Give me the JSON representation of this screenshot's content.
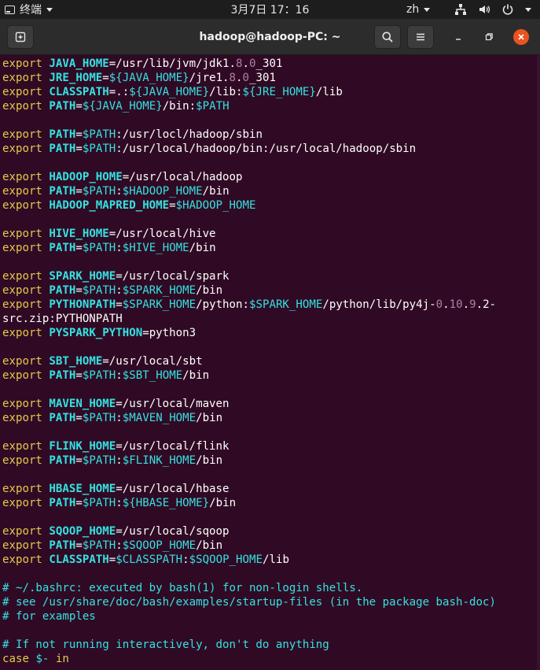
{
  "topbar": {
    "app_name": "终端",
    "clock": "3月7日  17：16",
    "language": "zh"
  },
  "window": {
    "title": "hadoop@hadoop-PC: ~"
  },
  "terminal": {
    "lines": [
      [
        [
          "kw",
          "export "
        ],
        [
          "var",
          "JAVA_HOME"
        ],
        [
          "plain",
          "=/usr/lib/jvm/jdk1."
        ],
        [
          "num",
          "8"
        ],
        [
          "plain",
          "."
        ],
        [
          "num",
          "0"
        ],
        [
          "plain",
          "_301"
        ]
      ],
      [
        [
          "kw",
          "export "
        ],
        [
          "var",
          "JRE_HOME"
        ],
        [
          "plain",
          "="
        ],
        [
          "val",
          "${JAVA_HOME}"
        ],
        [
          "plain",
          "/jre1."
        ],
        [
          "num",
          "8"
        ],
        [
          "plain",
          "."
        ],
        [
          "num",
          "0"
        ],
        [
          "plain",
          "_301"
        ]
      ],
      [
        [
          "kw",
          "export "
        ],
        [
          "var",
          "CLASSPATH"
        ],
        [
          "plain",
          "=.:"
        ],
        [
          "val",
          "${JAVA_HOME}"
        ],
        [
          "plain",
          "/lib:"
        ],
        [
          "val",
          "${JRE_HOME}"
        ],
        [
          "plain",
          "/lib"
        ]
      ],
      [
        [
          "kw",
          "export "
        ],
        [
          "var",
          "PATH"
        ],
        [
          "plain",
          "="
        ],
        [
          "val",
          "${JAVA_HOME}"
        ],
        [
          "plain",
          "/bin:"
        ],
        [
          "val",
          "$PATH"
        ]
      ],
      [],
      [
        [
          "kw",
          "export "
        ],
        [
          "var",
          "PATH"
        ],
        [
          "plain",
          "="
        ],
        [
          "val",
          "$PATH"
        ],
        [
          "plain",
          ":/usr/locl/hadoop/sbin"
        ]
      ],
      [
        [
          "kw",
          "export "
        ],
        [
          "var",
          "PATH"
        ],
        [
          "plain",
          "="
        ],
        [
          "val",
          "$PATH"
        ],
        [
          "plain",
          ":/usr/local/hadoop/bin:/usr/local/hadoop/sbin"
        ]
      ],
      [],
      [
        [
          "kw",
          "export "
        ],
        [
          "var",
          "HADOOP_HOME"
        ],
        [
          "plain",
          "=/usr/local/hadoop"
        ]
      ],
      [
        [
          "kw",
          "export "
        ],
        [
          "var",
          "PATH"
        ],
        [
          "plain",
          "="
        ],
        [
          "val",
          "$PATH"
        ],
        [
          "plain",
          ":"
        ],
        [
          "val",
          "$HADOOP_HOME"
        ],
        [
          "plain",
          "/bin"
        ]
      ],
      [
        [
          "kw",
          "export "
        ],
        [
          "var",
          "HADOOP_MAPRED_HOME"
        ],
        [
          "plain",
          "="
        ],
        [
          "val",
          "$HADOOP_HOME"
        ]
      ],
      [],
      [
        [
          "kw",
          "export "
        ],
        [
          "var",
          "HIVE_HOME"
        ],
        [
          "plain",
          "=/usr/local/hive"
        ]
      ],
      [
        [
          "kw",
          "export "
        ],
        [
          "var",
          "PATH"
        ],
        [
          "plain",
          "="
        ],
        [
          "val",
          "$PATH"
        ],
        [
          "plain",
          ":"
        ],
        [
          "val",
          "$HIVE_HOME"
        ],
        [
          "plain",
          "/bin"
        ]
      ],
      [],
      [
        [
          "kw",
          "export "
        ],
        [
          "var",
          "SPARK_HOME"
        ],
        [
          "plain",
          "=/usr/local/spark"
        ]
      ],
      [
        [
          "kw",
          "export "
        ],
        [
          "var",
          "PATH"
        ],
        [
          "plain",
          "="
        ],
        [
          "val",
          "$PATH"
        ],
        [
          "plain",
          ":"
        ],
        [
          "val",
          "$SPARK_HOME"
        ],
        [
          "plain",
          "/bin"
        ]
      ],
      [
        [
          "kw",
          "export "
        ],
        [
          "var",
          "PYTHONPATH"
        ],
        [
          "plain",
          "="
        ],
        [
          "val",
          "$SPARK_HOME"
        ],
        [
          "plain",
          "/python:"
        ],
        [
          "val",
          "$SPARK_HOME"
        ],
        [
          "plain",
          "/python/lib/py4j-"
        ],
        [
          "num",
          "0"
        ],
        [
          "plain",
          "."
        ],
        [
          "num",
          "10"
        ],
        [
          "plain",
          "."
        ],
        [
          "num",
          "9"
        ],
        [
          "plain",
          ".2-"
        ]
      ],
      [
        [
          "plain",
          "src.zip:PYTHONPATH"
        ]
      ],
      [
        [
          "kw",
          "export "
        ],
        [
          "var",
          "PYSPARK_PYTHON"
        ],
        [
          "plain",
          "=python3"
        ]
      ],
      [],
      [
        [
          "kw",
          "export "
        ],
        [
          "var",
          "SBT_HOME"
        ],
        [
          "plain",
          "=/usr/local/sbt"
        ]
      ],
      [
        [
          "kw",
          "export "
        ],
        [
          "var",
          "PATH"
        ],
        [
          "plain",
          "="
        ],
        [
          "val",
          "$PATH"
        ],
        [
          "plain",
          ":"
        ],
        [
          "val",
          "$SBT_HOME"
        ],
        [
          "plain",
          "/bin"
        ]
      ],
      [],
      [
        [
          "kw",
          "export "
        ],
        [
          "var",
          "MAVEN_HOME"
        ],
        [
          "plain",
          "=/usr/local/maven"
        ]
      ],
      [
        [
          "kw",
          "export "
        ],
        [
          "var",
          "PATH"
        ],
        [
          "plain",
          "="
        ],
        [
          "val",
          "$PATH"
        ],
        [
          "plain",
          ":"
        ],
        [
          "val",
          "$MAVEN_HOME"
        ],
        [
          "plain",
          "/bin"
        ]
      ],
      [],
      [
        [
          "kw",
          "export "
        ],
        [
          "var",
          "FLINK_HOME"
        ],
        [
          "plain",
          "=/usr/local/flink"
        ]
      ],
      [
        [
          "kw",
          "export "
        ],
        [
          "var",
          "PATH"
        ],
        [
          "plain",
          "="
        ],
        [
          "val",
          "$PATH"
        ],
        [
          "plain",
          ":"
        ],
        [
          "val",
          "$FLINK_HOME"
        ],
        [
          "plain",
          "/bin"
        ]
      ],
      [],
      [
        [
          "kw",
          "export "
        ],
        [
          "var",
          "HBASE_HOME"
        ],
        [
          "plain",
          "=/usr/local/hbase"
        ]
      ],
      [
        [
          "kw",
          "export "
        ],
        [
          "var",
          "PATH"
        ],
        [
          "plain",
          "="
        ],
        [
          "val",
          "$PATH"
        ],
        [
          "plain",
          ":"
        ],
        [
          "val",
          "${HBASE_HOME}"
        ],
        [
          "plain",
          "/bin"
        ]
      ],
      [],
      [
        [
          "kw",
          "export "
        ],
        [
          "var",
          "SQOOP_HOME"
        ],
        [
          "plain",
          "=/usr/local/sqoop"
        ]
      ],
      [
        [
          "kw",
          "export "
        ],
        [
          "var",
          "PATH"
        ],
        [
          "plain",
          "="
        ],
        [
          "val",
          "$PATH"
        ],
        [
          "plain",
          ":"
        ],
        [
          "val",
          "$SQOOP_HOME"
        ],
        [
          "plain",
          "/bin"
        ]
      ],
      [
        [
          "kw",
          "export "
        ],
        [
          "var",
          "CLASSPATH"
        ],
        [
          "plain",
          "="
        ],
        [
          "val",
          "$CLASSPATH"
        ],
        [
          "plain",
          ":"
        ],
        [
          "val",
          "$SQOOP_HOME"
        ],
        [
          "plain",
          "/lib"
        ]
      ],
      [],
      [
        [
          "comment",
          "# ~/.bashrc: executed by bash(1) for non-login shells."
        ]
      ],
      [
        [
          "comment",
          "# see /usr/share/doc/bash/examples/startup-files (in the package bash-doc)"
        ]
      ],
      [
        [
          "comment",
          "# for examples"
        ]
      ],
      [],
      [
        [
          "comment",
          "# If not running interactively, don't do anything"
        ]
      ],
      [
        [
          "kw",
          "case "
        ],
        [
          "val",
          "$-"
        ],
        [
          "kw",
          " in"
        ]
      ]
    ]
  }
}
